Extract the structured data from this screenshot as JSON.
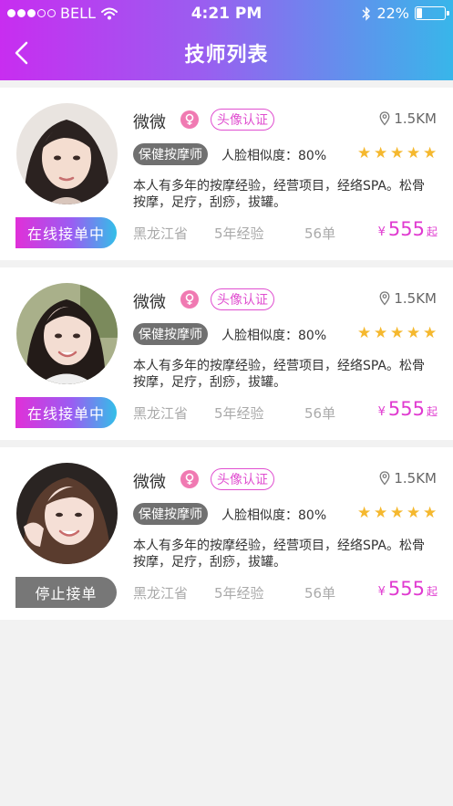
{
  "status_bar": {
    "carrier": "BELL",
    "time": "4:21 PM",
    "battery": "22%",
    "battery_level": 0.22
  },
  "nav": {
    "title": "技师列表",
    "back_icon": "chevron-left-icon"
  },
  "colors": {
    "header_gradient_start": "#c82df0",
    "header_gradient_end": "#38b6ea",
    "accent_pink": "#e04fd0",
    "star": "#f5b82e"
  },
  "technicians": [
    {
      "name": "微微",
      "gender_icon": "female-icon",
      "verify_label": "头像认证",
      "distance": "1.5KM",
      "role": "保健按摩师",
      "similarity": "人脸相似度：80%",
      "rating": 5,
      "description": "本人有多年的按摩经验，经营项目，经络SPA。松骨按摩，足疗，刮痧，拔罐。",
      "province": "黑龙江省",
      "experience": "5年经验",
      "orders": "56单",
      "currency": "¥",
      "price": "555",
      "price_suffix": "起",
      "status": "在线接单中",
      "status_type": "online"
    },
    {
      "name": "微微",
      "gender_icon": "female-icon",
      "verify_label": "头像认证",
      "distance": "1.5KM",
      "role": "保健按摩师",
      "similarity": "人脸相似度：80%",
      "rating": 5,
      "description": "本人有多年的按摩经验，经营项目，经络SPA。松骨按摩，足疗，刮痧，拔罐。",
      "province": "黑龙江省",
      "experience": "5年经验",
      "orders": "56单",
      "currency": "¥",
      "price": "555",
      "price_suffix": "起",
      "status": "在线接单中",
      "status_type": "online"
    },
    {
      "name": "微微",
      "gender_icon": "female-icon",
      "verify_label": "头像认证",
      "distance": "1.5KM",
      "role": "保健按摩师",
      "similarity": "人脸相似度：80%",
      "rating": 5,
      "description": "本人有多年的按摩经验，经营项目，经络SPA。松骨按摩，足疗，刮痧，拔罐。",
      "province": "黑龙江省",
      "experience": "5年经验",
      "orders": "56单",
      "currency": "¥",
      "price": "555",
      "price_suffix": "起",
      "status": "停止接单",
      "status_type": "stopped"
    }
  ]
}
